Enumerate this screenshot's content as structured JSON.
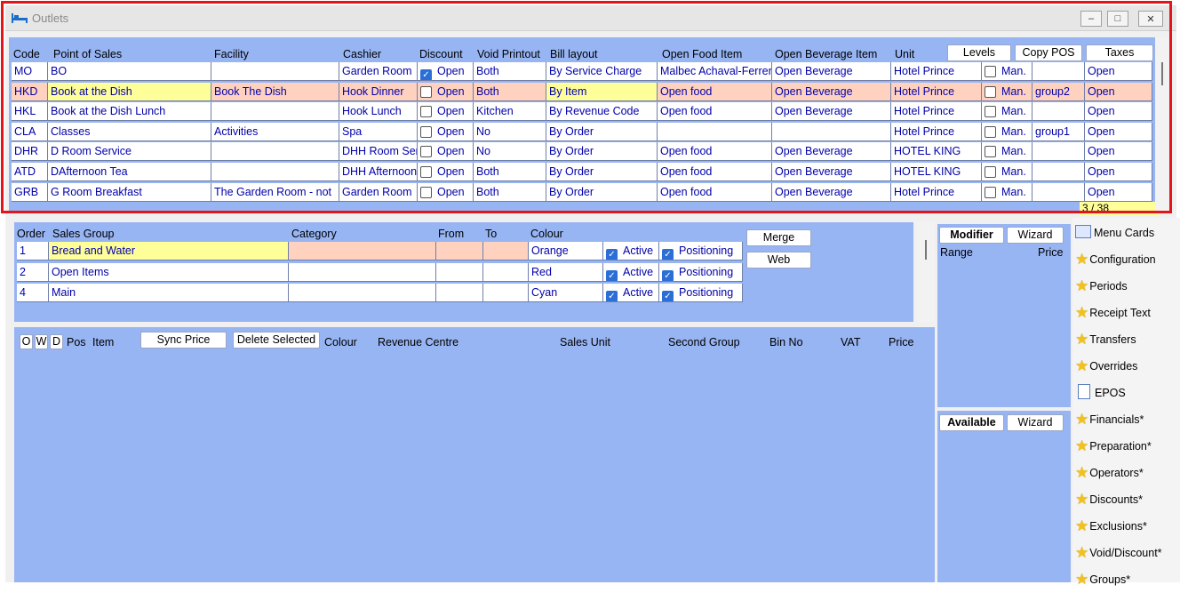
{
  "window": {
    "title": "Outlets",
    "minimize": "–",
    "maximize": "□",
    "close": "✕"
  },
  "outlets": {
    "headers": [
      "Code",
      "Point of Sales",
      "Facility",
      "Cashier",
      "Discount",
      "Void Printout",
      "Bill layout",
      "Open Food Item",
      "Open Beverage Item",
      "Unit"
    ],
    "buttons": {
      "levels": "Levels",
      "copy_pos": "Copy POS",
      "taxes": "Taxes"
    },
    "page_indicator": "3 / 38",
    "rows": [
      {
        "code": "MO",
        "pos": "BO",
        "facility": "",
        "cashier": "Garden Room",
        "discount_checked": true,
        "discount": "Open",
        "void": "Both",
        "bill": "By Service Charge",
        "food": "Malbec Achaval-Ferrer",
        "bev": "Open Beverage",
        "unit": "Hotel Prince",
        "man": "Man.",
        "group": "",
        "tax": "Open",
        "hl": ""
      },
      {
        "code": "HKD",
        "pos": "Book at the Dish",
        "facility": "Book The Dish",
        "cashier": "Hook Dinner",
        "discount_checked": false,
        "discount": "Open",
        "void": "Both",
        "bill": "By Item",
        "food": "Open food",
        "bev": "Open Beverage",
        "unit": "Hotel Prince",
        "man": "Man.",
        "group": "group2",
        "tax": "Open",
        "hl": "sel"
      },
      {
        "code": "HKL",
        "pos": "Book at the Dish Lunch",
        "facility": "",
        "cashier": "Hook Lunch",
        "discount_checked": false,
        "discount": "Open",
        "void": "Kitchen",
        "bill": "By Revenue Code",
        "food": "Open food",
        "bev": "Open Beverage",
        "unit": "Hotel Prince",
        "man": "Man.",
        "group": "",
        "tax": "Open",
        "hl": ""
      },
      {
        "code": "CLA",
        "pos": "Classes",
        "facility": "Activities",
        "cashier": "Spa",
        "discount_checked": false,
        "discount": "Open",
        "void": "No",
        "bill": "By Order",
        "food": "",
        "bev": "",
        "unit": "Hotel Prince",
        "man": "Man.",
        "group": "group1",
        "tax": "Open",
        "hl": ""
      },
      {
        "code": "DHR",
        "pos": "D Room Service",
        "facility": "",
        "cashier": "DHH Room Service",
        "discount_checked": false,
        "discount": "Open",
        "void": "No",
        "bill": "By Order",
        "food": "Open food",
        "bev": "Open Beverage",
        "unit": "HOTEL KING",
        "man": "Man.",
        "group": "",
        "tax": "Open",
        "hl": ""
      },
      {
        "code": "ATD",
        "pos": "DAfternoon Tea",
        "facility": "",
        "cashier": "DHH Afternoon",
        "discount_checked": false,
        "discount": "Open",
        "void": "Both",
        "bill": "By Order",
        "food": "Open food",
        "bev": "Open Beverage",
        "unit": "HOTEL KING",
        "man": "Man.",
        "group": "",
        "tax": "Open",
        "hl": ""
      },
      {
        "code": "GRB",
        "pos": "G Room Breakfast",
        "facility": "The Garden Room - not",
        "cashier": "Garden Room",
        "discount_checked": false,
        "discount": "Open",
        "void": "Both",
        "bill": "By Order",
        "food": "Open food",
        "bev": "Open Beverage",
        "unit": "Hotel Prince",
        "man": "Man.",
        "group": "",
        "tax": "Open",
        "hl": ""
      }
    ]
  },
  "sales_groups": {
    "headers": [
      "Order",
      "Sales Group",
      "Category",
      "From",
      "To",
      "Colour"
    ],
    "buttons": {
      "merge": "Merge",
      "web": "Web"
    },
    "rows": [
      {
        "order": "1",
        "group": "Bread and Water",
        "category": "",
        "from": "",
        "to": "",
        "colour": "Orange",
        "active": "Active",
        "positioning": "Positioning",
        "hl": true
      },
      {
        "order": "2",
        "group": "Open Items",
        "category": "",
        "from": "",
        "to": "",
        "colour": "Red",
        "active": "Active",
        "positioning": "Positioning",
        "hl": false
      },
      {
        "order": "4",
        "group": "Main",
        "category": "",
        "from": "",
        "to": "",
        "colour": "Cyan",
        "active": "Active",
        "positioning": "Positioning",
        "hl": false
      }
    ]
  },
  "items": {
    "toggles": [
      "O",
      "W",
      "D"
    ],
    "pos": "Pos",
    "item": "Item",
    "sync_price": "Sync Price",
    "delete_selected": "Delete Selected",
    "headers": [
      "Colour",
      "Revenue Centre",
      "Sales Unit",
      "Second Group",
      "Bin No",
      "VAT",
      "Price"
    ]
  },
  "modifier": {
    "tab": "Modifier",
    "wizard": "Wizard",
    "range": "Range",
    "price": "Price"
  },
  "available": {
    "tab": "Available",
    "wizard": "Wizard"
  },
  "sidebar": {
    "items": [
      {
        "label": "Menu Cards",
        "icon": "menu-cards-icon"
      },
      {
        "label": "Configuration",
        "icon": "star-icon"
      },
      {
        "label": "Periods",
        "icon": "star-icon"
      },
      {
        "label": "Receipt Text",
        "icon": "star-icon"
      },
      {
        "label": "Transfers",
        "icon": "star-icon"
      },
      {
        "label": "Overrides",
        "icon": "star-icon"
      },
      {
        "label": "EPOS",
        "icon": "document-icon"
      },
      {
        "label": "Financials*",
        "icon": "star-icon"
      },
      {
        "label": "Preparation*",
        "icon": "star-icon"
      },
      {
        "label": "Operators*",
        "icon": "star-icon"
      },
      {
        "label": "Discounts*",
        "icon": "star-icon"
      },
      {
        "label": "Exclusions*",
        "icon": "star-icon"
      },
      {
        "label": "Void/Discount*",
        "icon": "star-icon"
      },
      {
        "label": "Groups*",
        "icon": "star-icon"
      }
    ]
  }
}
